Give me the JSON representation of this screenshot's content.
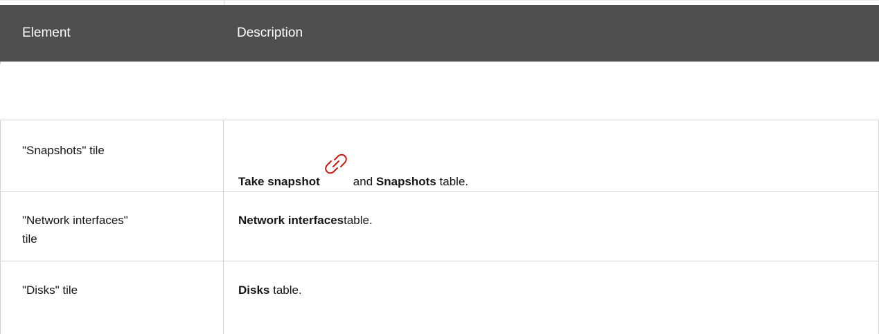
{
  "header": {
    "col1": "Element",
    "col2": "Description"
  },
  "rows": [
    {
      "element": "\"Snapshots\" tile",
      "desc_parts": {
        "strong1": "Take snapshot",
        "mid": "and",
        "strong2": "Snapshots",
        "end": "table."
      }
    },
    {
      "element_line1": "\"Network interfaces\"",
      "element_line2": "tile",
      "desc_parts": {
        "strong1": "Network interfaces",
        "end": "table."
      }
    },
    {
      "element": "\"Disks\" tile",
      "desc_parts": {
        "strong1": "Disks",
        "end": "table."
      }
    }
  ],
  "icons": {
    "snapshot_link_icon": "link-icon",
    "snapshot_link_color": "#c9190b"
  },
  "colors": {
    "header_bg": "#4f4f4f",
    "header_text": "#ffffff",
    "border": "#d2d2d2"
  }
}
